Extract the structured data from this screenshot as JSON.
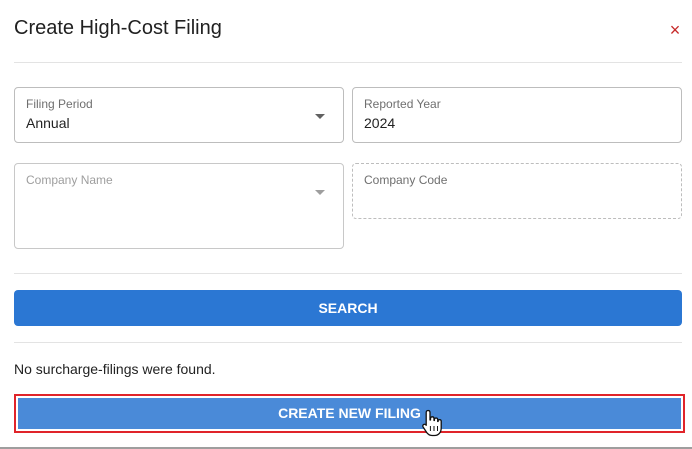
{
  "dialog": {
    "title": "Create High-Cost Filing",
    "close_symbol": "×"
  },
  "form": {
    "filing_period": {
      "label": "Filing Period",
      "value": "Annual"
    },
    "reported_year": {
      "label": "Reported Year",
      "value": "2024"
    },
    "company_name": {
      "label": "Company Name",
      "value": ""
    },
    "company_code": {
      "label": "Company Code",
      "value": ""
    }
  },
  "actions": {
    "search_label": "SEARCH",
    "create_label": "CREATE NEW FILING"
  },
  "results": {
    "message": "No surcharge-filings were found."
  },
  "colors": {
    "primary": "#2b77d3",
    "create_button": "#4a8ad8",
    "highlight_border": "#e0242a",
    "close_icon": "#c62828"
  },
  "icons": [
    "close-icon",
    "dropdown-caret-icon",
    "hand-pointer-cursor-icon"
  ]
}
